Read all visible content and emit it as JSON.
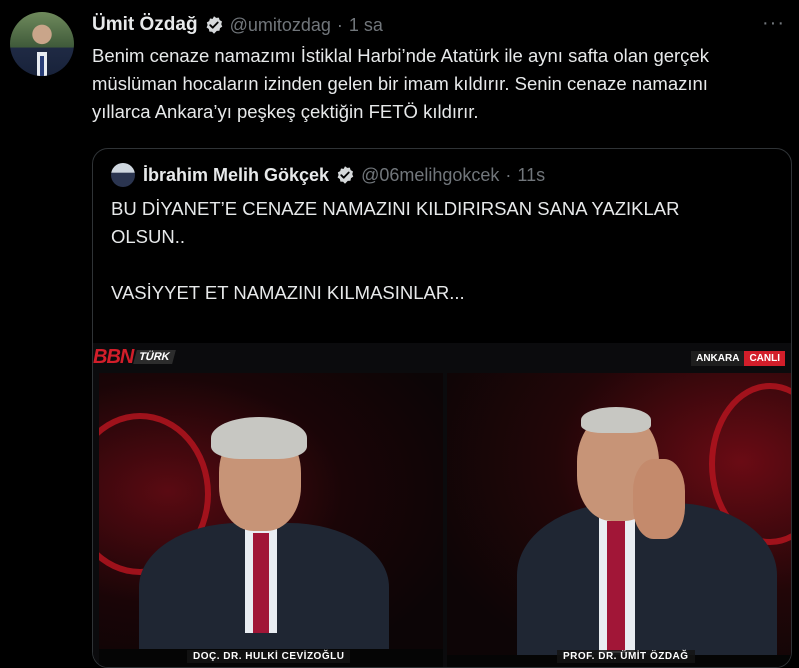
{
  "tweet": {
    "author_name": "Ümit Özdağ",
    "handle": "@umitozdag",
    "separator": "·",
    "time": "1 sa",
    "more": "···",
    "text_line1": "Benim cenaze namazımı İstiklal Harbi’nde Atatürk ile aynı safta olan gerçek",
    "text_line2": "müslüman hocaların izinden gelen bir imam kıldırır. Senin cenaze namazını",
    "text_line3": "yıllarca Ankara’yı peşkeş çektiğin FETÖ kıldırır."
  },
  "quoted_tweet": {
    "author_name": "İbrahim Melih Gökçek",
    "handle": "@06melihgokcek",
    "separator": "·",
    "time": "11s",
    "text_line1": "BU DİYANET’E CENAZE NAMAZINI KILDIRIRSAN SANA YAZIKLAR",
    "text_line2": "OLSUN..",
    "text_line3": "VASİYYET ET NAMAZINI KILMASINLAR..."
  },
  "video": {
    "channel_logo": "BBN",
    "channel_logo_suffix": "TÜRK",
    "location_badge": "ANKARA",
    "live_badge": "CANLI",
    "left_caption": "DOÇ. DR. HULKİ CEVİZOĞLU",
    "right_caption": "PROF. DR. ÜMİT ÖZDAĞ"
  },
  "icons": {
    "verified": "verified-badge-icon",
    "more": "more-options-icon"
  },
  "colors": {
    "background": "#000000",
    "text_primary": "#e7e9ea",
    "text_secondary": "#71767b",
    "border": "#2f3336",
    "brand_red": "#d21e2a"
  }
}
